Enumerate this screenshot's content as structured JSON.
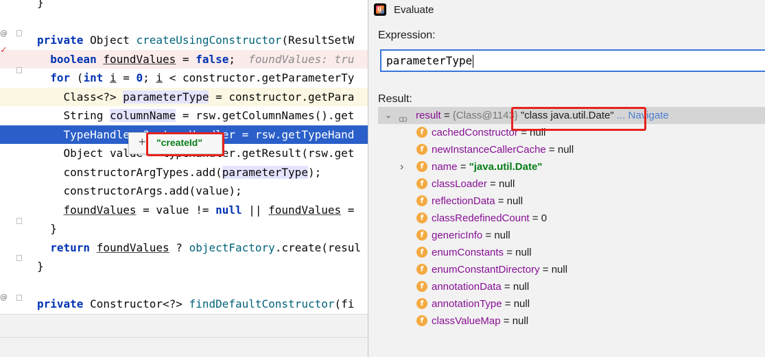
{
  "editor": {
    "lines": [
      {
        "segments": [
          {
            "t": "}"
          }
        ]
      },
      {
        "segments": [
          {
            "t": ""
          }
        ]
      },
      {
        "segments": [
          {
            "t": "private ",
            "c": "kw"
          },
          {
            "t": "Object "
          },
          {
            "t": "createUsingConstructor",
            "c": "mth"
          },
          {
            "t": "(ResultSetW"
          }
        ]
      },
      {
        "segments": [
          {
            "t": "  "
          },
          {
            "t": "boolean ",
            "c": "kw"
          },
          {
            "t": "foundValues",
            "c": "ul"
          },
          {
            "t": " = "
          },
          {
            "t": "false",
            "c": "kw"
          },
          {
            "t": ";  "
          },
          {
            "t": "foundValues: tru",
            "c": "dim"
          }
        ]
      },
      {
        "segments": [
          {
            "t": "  "
          },
          {
            "t": "for ",
            "c": "kw"
          },
          {
            "t": "("
          },
          {
            "t": "int ",
            "c": "kw"
          },
          {
            "t": "i",
            "c": "ul"
          },
          {
            "t": " = "
          },
          {
            "t": "0",
            "c": "kw"
          },
          {
            "t": "; "
          },
          {
            "t": "i",
            "c": "ul"
          },
          {
            "t": " < constructor.getParameterTy"
          }
        ]
      },
      {
        "segments": [
          {
            "t": "    Class<?> "
          },
          {
            "t": "parameterType",
            "c": "hl-var"
          },
          {
            "t": " = constructor.getPara"
          }
        ]
      },
      {
        "segments": [
          {
            "t": "    String "
          },
          {
            "t": "columnName",
            "c": "hl-var"
          },
          {
            "t": " = rsw.getColumnNames().get"
          }
        ]
      },
      {
        "segments": [
          {
            "t": "    TypeHandler<?> typeHandler = rsw.getTypeHand"
          }
        ]
      },
      {
        "segments": [
          {
            "t": "    Object value = typeHandler.getResult(rsw.get"
          }
        ]
      },
      {
        "segments": [
          {
            "t": "    constructorArgTypes.add("
          },
          {
            "t": "parameterType",
            "c": "hl-var"
          },
          {
            "t": ");"
          }
        ]
      },
      {
        "segments": [
          {
            "t": "    constructorArgs.add(value);"
          }
        ]
      },
      {
        "segments": [
          {
            "t": "    "
          },
          {
            "t": "foundValues",
            "c": "ul"
          },
          {
            "t": " = value != "
          },
          {
            "t": "null",
            "c": "kw"
          },
          {
            "t": " || "
          },
          {
            "t": "foundValues",
            "c": "ul"
          },
          {
            "t": " ="
          }
        ]
      },
      {
        "segments": [
          {
            "t": "  }"
          }
        ]
      },
      {
        "segments": [
          {
            "t": "  "
          },
          {
            "t": "return ",
            "c": "kw"
          },
          {
            "t": "foundValues",
            "c": "ul"
          },
          {
            "t": " ? "
          },
          {
            "t": "objectFactory",
            "c": "mth"
          },
          {
            "t": ".create(resul"
          }
        ]
      },
      {
        "segments": [
          {
            "t": "}"
          }
        ]
      },
      {
        "segments": [
          {
            "t": ""
          }
        ]
      },
      {
        "segments": [
          {
            "t": "private ",
            "c": "kw"
          },
          {
            "t": "Constructor<?> "
          },
          {
            "t": "findDefaultConstructor",
            "c": "mth"
          },
          {
            "t": "(fi"
          }
        ]
      }
    ],
    "tooltip": {
      "plus": "+",
      "value": "\"createId\""
    }
  },
  "evaluate": {
    "title": "Evaluate",
    "icon_text": "IJ",
    "expression_label": "Expression:",
    "expression_value": "parameterType",
    "result_label": "Result:",
    "result": {
      "name": "result",
      "eq": " = ",
      "class_ref": "{Class@1143}",
      "value": "\"class java.util.Date\"",
      "navigate": "... Navigate"
    },
    "fields": [
      {
        "name": "cachedConstructor",
        "eq": " = ",
        "value": "null"
      },
      {
        "name": "newInstanceCallerCache",
        "eq": " = ",
        "value": "null"
      },
      {
        "name": "name",
        "eq": " = ",
        "value": "\"java.util.Date\"",
        "str": true,
        "expandable": true
      },
      {
        "name": "classLoader",
        "eq": " = ",
        "value": "null"
      },
      {
        "name": "reflectionData",
        "eq": " = ",
        "value": "null"
      },
      {
        "name": "classRedefinedCount",
        "eq": " = ",
        "value": "0"
      },
      {
        "name": "genericInfo",
        "eq": " = ",
        "value": "null"
      },
      {
        "name": "enumConstants",
        "eq": " = ",
        "value": "null"
      },
      {
        "name": "enumConstantDirectory",
        "eq": " = ",
        "value": "null"
      },
      {
        "name": "annotationData",
        "eq": " = ",
        "value": "null"
      },
      {
        "name": "annotationType",
        "eq": " = ",
        "value": "null"
      },
      {
        "name": "classValueMap",
        "eq": " = ",
        "value": "null"
      }
    ]
  },
  "colors": {
    "keyword": "#0033b3",
    "string": "#067d17",
    "field": "#871094",
    "annotation_box": "#e6221d",
    "selection": "#2a5fc9"
  }
}
